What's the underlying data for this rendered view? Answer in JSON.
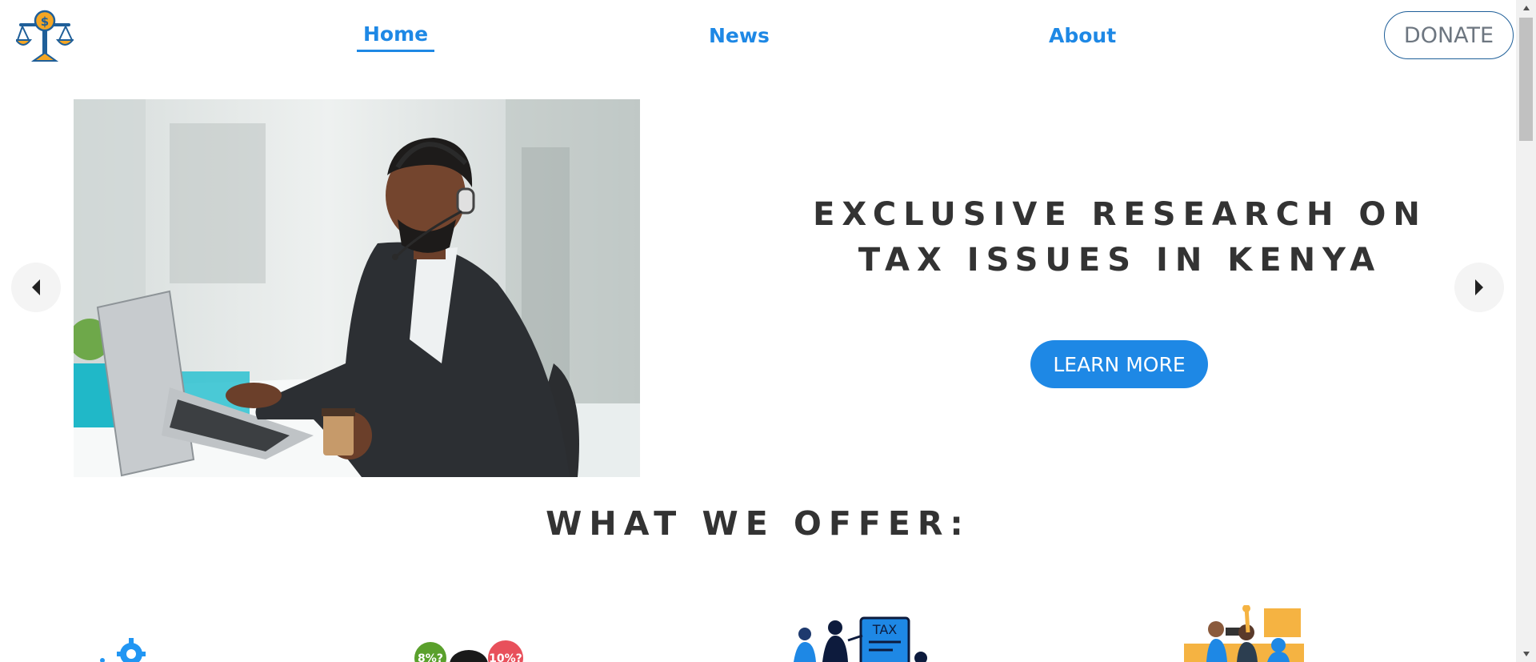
{
  "nav": {
    "home_label": "Home",
    "news_label": "News",
    "about_label": "About",
    "donate_label": "DONATE",
    "active": "Home"
  },
  "logo": {
    "icon": "scales-of-justice-dollar-icon",
    "symbol": "$"
  },
  "hero": {
    "title": "EXCLUSIVE RESEARCH ON TAX ISSUES IN KENYA",
    "button_label": "LEARN MORE",
    "image": "man-with-headset-typing-on-laptop-photo"
  },
  "carousel": {
    "prev_icon": "caret-left-icon",
    "next_icon": "caret-right-icon"
  },
  "offer": {
    "title": "WHAT WE OFFER:",
    "icons": [
      {
        "icon": "gear-icon"
      },
      {
        "icon": "tax-percentage-people-icon",
        "labels": [
          "8%?",
          "10%?"
        ]
      },
      {
        "icon": "tax-consultation-icon",
        "labels": [
          "TAX"
        ]
      },
      {
        "icon": "protest-advocacy-icon"
      }
    ]
  },
  "colors": {
    "accent": "#1e88e5",
    "heading": "#333333",
    "donate_border": "#1f5f99",
    "logo_orange": "#f5a623"
  }
}
